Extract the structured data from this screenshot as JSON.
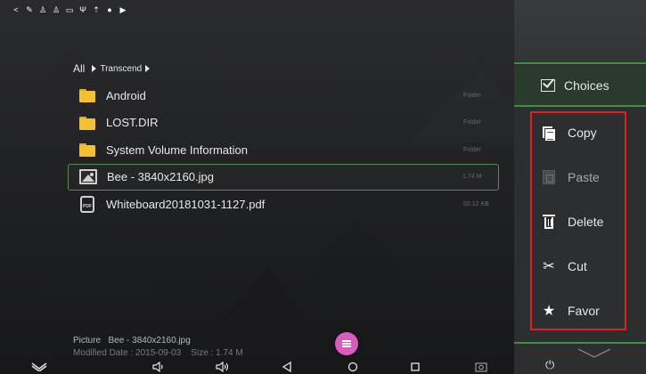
{
  "statusbar": {
    "icons": [
      "share-icon",
      "wrench-icon",
      "usb-person-icon",
      "usb-person-icon",
      "image-icon",
      "usb-icon",
      "upload-icon",
      "location-icon",
      "play-store-icon"
    ]
  },
  "breadcrumb": {
    "root": "All",
    "current": "Transcend"
  },
  "files": [
    {
      "name": "Android",
      "meta": "Folder",
      "type": "folder",
      "selected": false
    },
    {
      "name": "LOST.DIR",
      "meta": "Folder",
      "type": "folder",
      "selected": false
    },
    {
      "name": "System Volume Information",
      "meta": "Folder",
      "type": "folder",
      "selected": false
    },
    {
      "name": "Bee - 3840x2160.jpg",
      "meta": "1.74 M",
      "type": "image",
      "selected": true
    },
    {
      "name": "Whiteboard20181031-1127.pdf",
      "meta": "50.12 KB",
      "type": "pdf",
      "selected": false
    }
  ],
  "info": {
    "type_label": "Picture",
    "file_name": "Bee - 3840x2160.jpg",
    "modified_label": "Modified Date : 2015-09-03",
    "size_label": "Size : 1.74 M"
  },
  "panel": {
    "choices_label": "Choices",
    "menu": [
      {
        "label": "Copy",
        "icon": "copy-icon",
        "disabled": false
      },
      {
        "label": "Paste",
        "icon": "paste-icon",
        "disabled": true
      },
      {
        "label": "Delete",
        "icon": "trash-icon",
        "disabled": false
      },
      {
        "label": "Cut",
        "icon": "scissors-icon",
        "disabled": false
      },
      {
        "label": "Favor",
        "icon": "star-icon",
        "disabled": false
      }
    ],
    "power_icon": "power-icon"
  },
  "colors": {
    "accent_green": "#3f8f3e",
    "highlight_red": "#e02020",
    "fab_pink": "#d95bbd",
    "folder_yellow": "#f5c030"
  }
}
